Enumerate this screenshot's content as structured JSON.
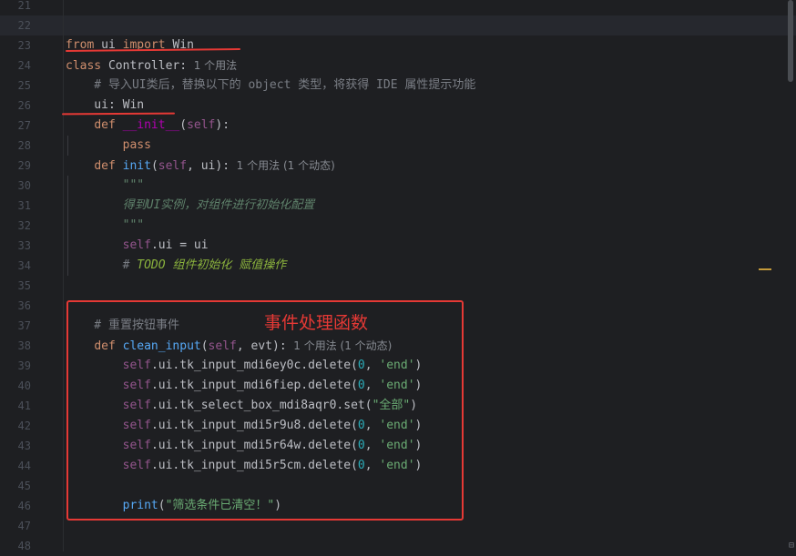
{
  "editor": {
    "lines": [
      {
        "n": "21",
        "tokens": []
      },
      {
        "n": "22",
        "current": true,
        "tokens": []
      },
      {
        "n": "23",
        "tokens": [
          {
            "t": "from",
            "c": "kw"
          },
          {
            "t": " "
          },
          {
            "t": "ui",
            "c": "id"
          },
          {
            "t": " "
          },
          {
            "t": "import",
            "c": "kw"
          },
          {
            "t": " Win"
          }
        ]
      },
      {
        "n": "24",
        "tokens": [
          {
            "t": "class",
            "c": "kw"
          },
          {
            "t": " Controller:"
          },
          {
            "t": "  1 个用法",
            "c": "hint"
          }
        ]
      },
      {
        "n": "25",
        "tokens": [
          {
            "t": "    # 导入UI类后，替换以下的 object 类型，将获得 IDE 属性提示功能",
            "c": "cmt"
          }
        ]
      },
      {
        "n": "26",
        "tokens": [
          {
            "t": "    ui: Win"
          }
        ]
      },
      {
        "n": "27",
        "tokens": [
          {
            "t": "    "
          },
          {
            "t": "def",
            "c": "kw"
          },
          {
            "t": " "
          },
          {
            "t": "__init__",
            "c": "dunder"
          },
          {
            "t": "("
          },
          {
            "t": "self",
            "c": "selfkw"
          },
          {
            "t": "):"
          }
        ]
      },
      {
        "n": "28",
        "tokens": [
          {
            "t": "        "
          },
          {
            "t": "pass",
            "c": "kw"
          }
        ]
      },
      {
        "n": "29",
        "tokens": [
          {
            "t": "    "
          },
          {
            "t": "def",
            "c": "kw"
          },
          {
            "t": " "
          },
          {
            "t": "init",
            "c": "fn"
          },
          {
            "t": "("
          },
          {
            "t": "self",
            "c": "selfkw"
          },
          {
            "t": ", ui):"
          },
          {
            "t": "  1 个用法 (1 个动态)",
            "c": "hint"
          }
        ]
      },
      {
        "n": "30",
        "tokens": [
          {
            "t": "        \"\"\"",
            "c": "doc"
          }
        ]
      },
      {
        "n": "31",
        "tokens": [
          {
            "t": "        得到UI实例，对组件进行初始化配置",
            "c": "doc"
          }
        ]
      },
      {
        "n": "32",
        "tokens": [
          {
            "t": "        \"\"\"",
            "c": "doc"
          }
        ]
      },
      {
        "n": "33",
        "tokens": [
          {
            "t": "        "
          },
          {
            "t": "self",
            "c": "selfkw"
          },
          {
            "t": ".ui = ui"
          }
        ]
      },
      {
        "n": "34",
        "tokens": [
          {
            "t": "        # ",
            "c": "cmt"
          },
          {
            "t": "TODO 组件初始化 赋值操作",
            "c": "todo"
          }
        ]
      },
      {
        "n": "35",
        "tokens": []
      },
      {
        "n": "36",
        "tokens": []
      },
      {
        "n": "37",
        "tokens": [
          {
            "t": "    # 重置按钮事件",
            "c": "cmt"
          }
        ]
      },
      {
        "n": "38",
        "tokens": [
          {
            "t": "    "
          },
          {
            "t": "def",
            "c": "kw"
          },
          {
            "t": " "
          },
          {
            "t": "clean_input",
            "c": "fn"
          },
          {
            "t": "("
          },
          {
            "t": "self",
            "c": "selfkw"
          },
          {
            "t": ", evt):"
          },
          {
            "t": "  1 个用法 (1 个动态)",
            "c": "hint"
          }
        ]
      },
      {
        "n": "39",
        "tokens": [
          {
            "t": "        "
          },
          {
            "t": "self",
            "c": "selfkw"
          },
          {
            "t": ".ui.tk_input_mdi6ey0c.delete("
          },
          {
            "t": "0",
            "c": "num"
          },
          {
            "t": ", "
          },
          {
            "t": "'end'",
            "c": "str"
          },
          {
            "t": ")"
          }
        ]
      },
      {
        "n": "40",
        "tokens": [
          {
            "t": "        "
          },
          {
            "t": "self",
            "c": "selfkw"
          },
          {
            "t": ".ui.tk_input_mdi6fiep.delete("
          },
          {
            "t": "0",
            "c": "num"
          },
          {
            "t": ", "
          },
          {
            "t": "'end'",
            "c": "str"
          },
          {
            "t": ")"
          }
        ]
      },
      {
        "n": "41",
        "tokens": [
          {
            "t": "        "
          },
          {
            "t": "self",
            "c": "selfkw"
          },
          {
            "t": ".ui.tk_select_box_mdi8aqr0.set("
          },
          {
            "t": "\"全部\"",
            "c": "str"
          },
          {
            "t": ")"
          }
        ]
      },
      {
        "n": "42",
        "tokens": [
          {
            "t": "        "
          },
          {
            "t": "self",
            "c": "selfkw"
          },
          {
            "t": ".ui.tk_input_mdi5r9u8.delete("
          },
          {
            "t": "0",
            "c": "num"
          },
          {
            "t": ", "
          },
          {
            "t": "'end'",
            "c": "str"
          },
          {
            "t": ")"
          }
        ]
      },
      {
        "n": "43",
        "tokens": [
          {
            "t": "        "
          },
          {
            "t": "self",
            "c": "selfkw"
          },
          {
            "t": ".ui.tk_input_mdi5r64w.delete("
          },
          {
            "t": "0",
            "c": "num"
          },
          {
            "t": ", "
          },
          {
            "t": "'end'",
            "c": "str"
          },
          {
            "t": ")"
          }
        ]
      },
      {
        "n": "44",
        "tokens": [
          {
            "t": "        "
          },
          {
            "t": "self",
            "c": "selfkw"
          },
          {
            "t": ".ui.tk_input_mdi5r5cm.delete("
          },
          {
            "t": "0",
            "c": "num"
          },
          {
            "t": ", "
          },
          {
            "t": "'end'",
            "c": "str"
          },
          {
            "t": ")"
          }
        ]
      },
      {
        "n": "45",
        "tokens": []
      },
      {
        "n": "46",
        "tokens": [
          {
            "t": "        "
          },
          {
            "t": "print",
            "c": "fn"
          },
          {
            "t": "("
          },
          {
            "t": "\"筛选条件已清空！\"",
            "c": "str"
          },
          {
            "t": ")"
          }
        ]
      },
      {
        "n": "47",
        "tokens": []
      },
      {
        "n": "48",
        "tokens": []
      }
    ]
  },
  "annotation": {
    "label": "事件处理函数",
    "color": "#e53935"
  },
  "icons": {
    "corner": "split-icon"
  }
}
